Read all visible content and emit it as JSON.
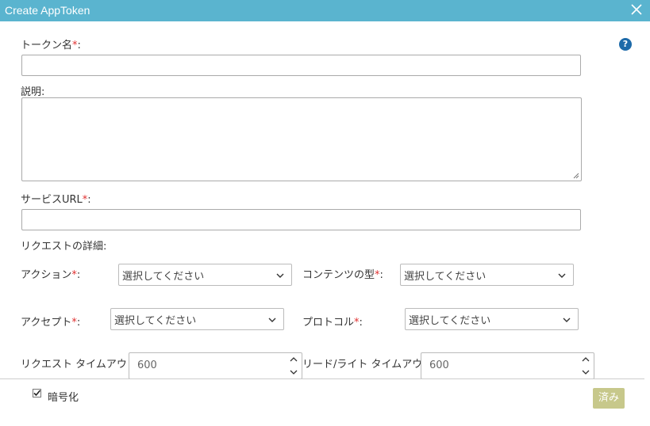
{
  "dialog": {
    "title": "Create AppToken",
    "close_icon": "close-icon",
    "help_glyph": "?"
  },
  "form": {
    "required_mark": "*",
    "token_name": {
      "label": "トークン名",
      "colon": ":",
      "value": ""
    },
    "description": {
      "label": "説明:",
      "value": ""
    },
    "service_url": {
      "label": "サービスURL",
      "colon": ":",
      "value": ""
    },
    "request_details_label": "リクエストの詳細:",
    "action": {
      "label": "アクション",
      "colon": ":",
      "selected": "選択してください"
    },
    "content_type": {
      "label": "コンテンツの型",
      "colon": ":",
      "selected": "選択してください"
    },
    "accept": {
      "label": "アクセプト",
      "colon": ":",
      "selected": "選択してください"
    },
    "protocol": {
      "label": "プロトコル",
      "colon": ":",
      "selected": "選択してください"
    },
    "request_timeout": {
      "label": "リクエスト タイムアウト:",
      "value": "600"
    },
    "rw_timeout": {
      "label": "リード/ライト タイムアウト:",
      "value": "600"
    }
  },
  "footer": {
    "encrypt_label": "暗号化",
    "encrypt_checked": true,
    "done_label": "済み"
  },
  "colors": {
    "titlebar": "#5ab4cf",
    "help": "#1d6aa9",
    "required": "#e03030",
    "done_button": "#c7c88b"
  }
}
